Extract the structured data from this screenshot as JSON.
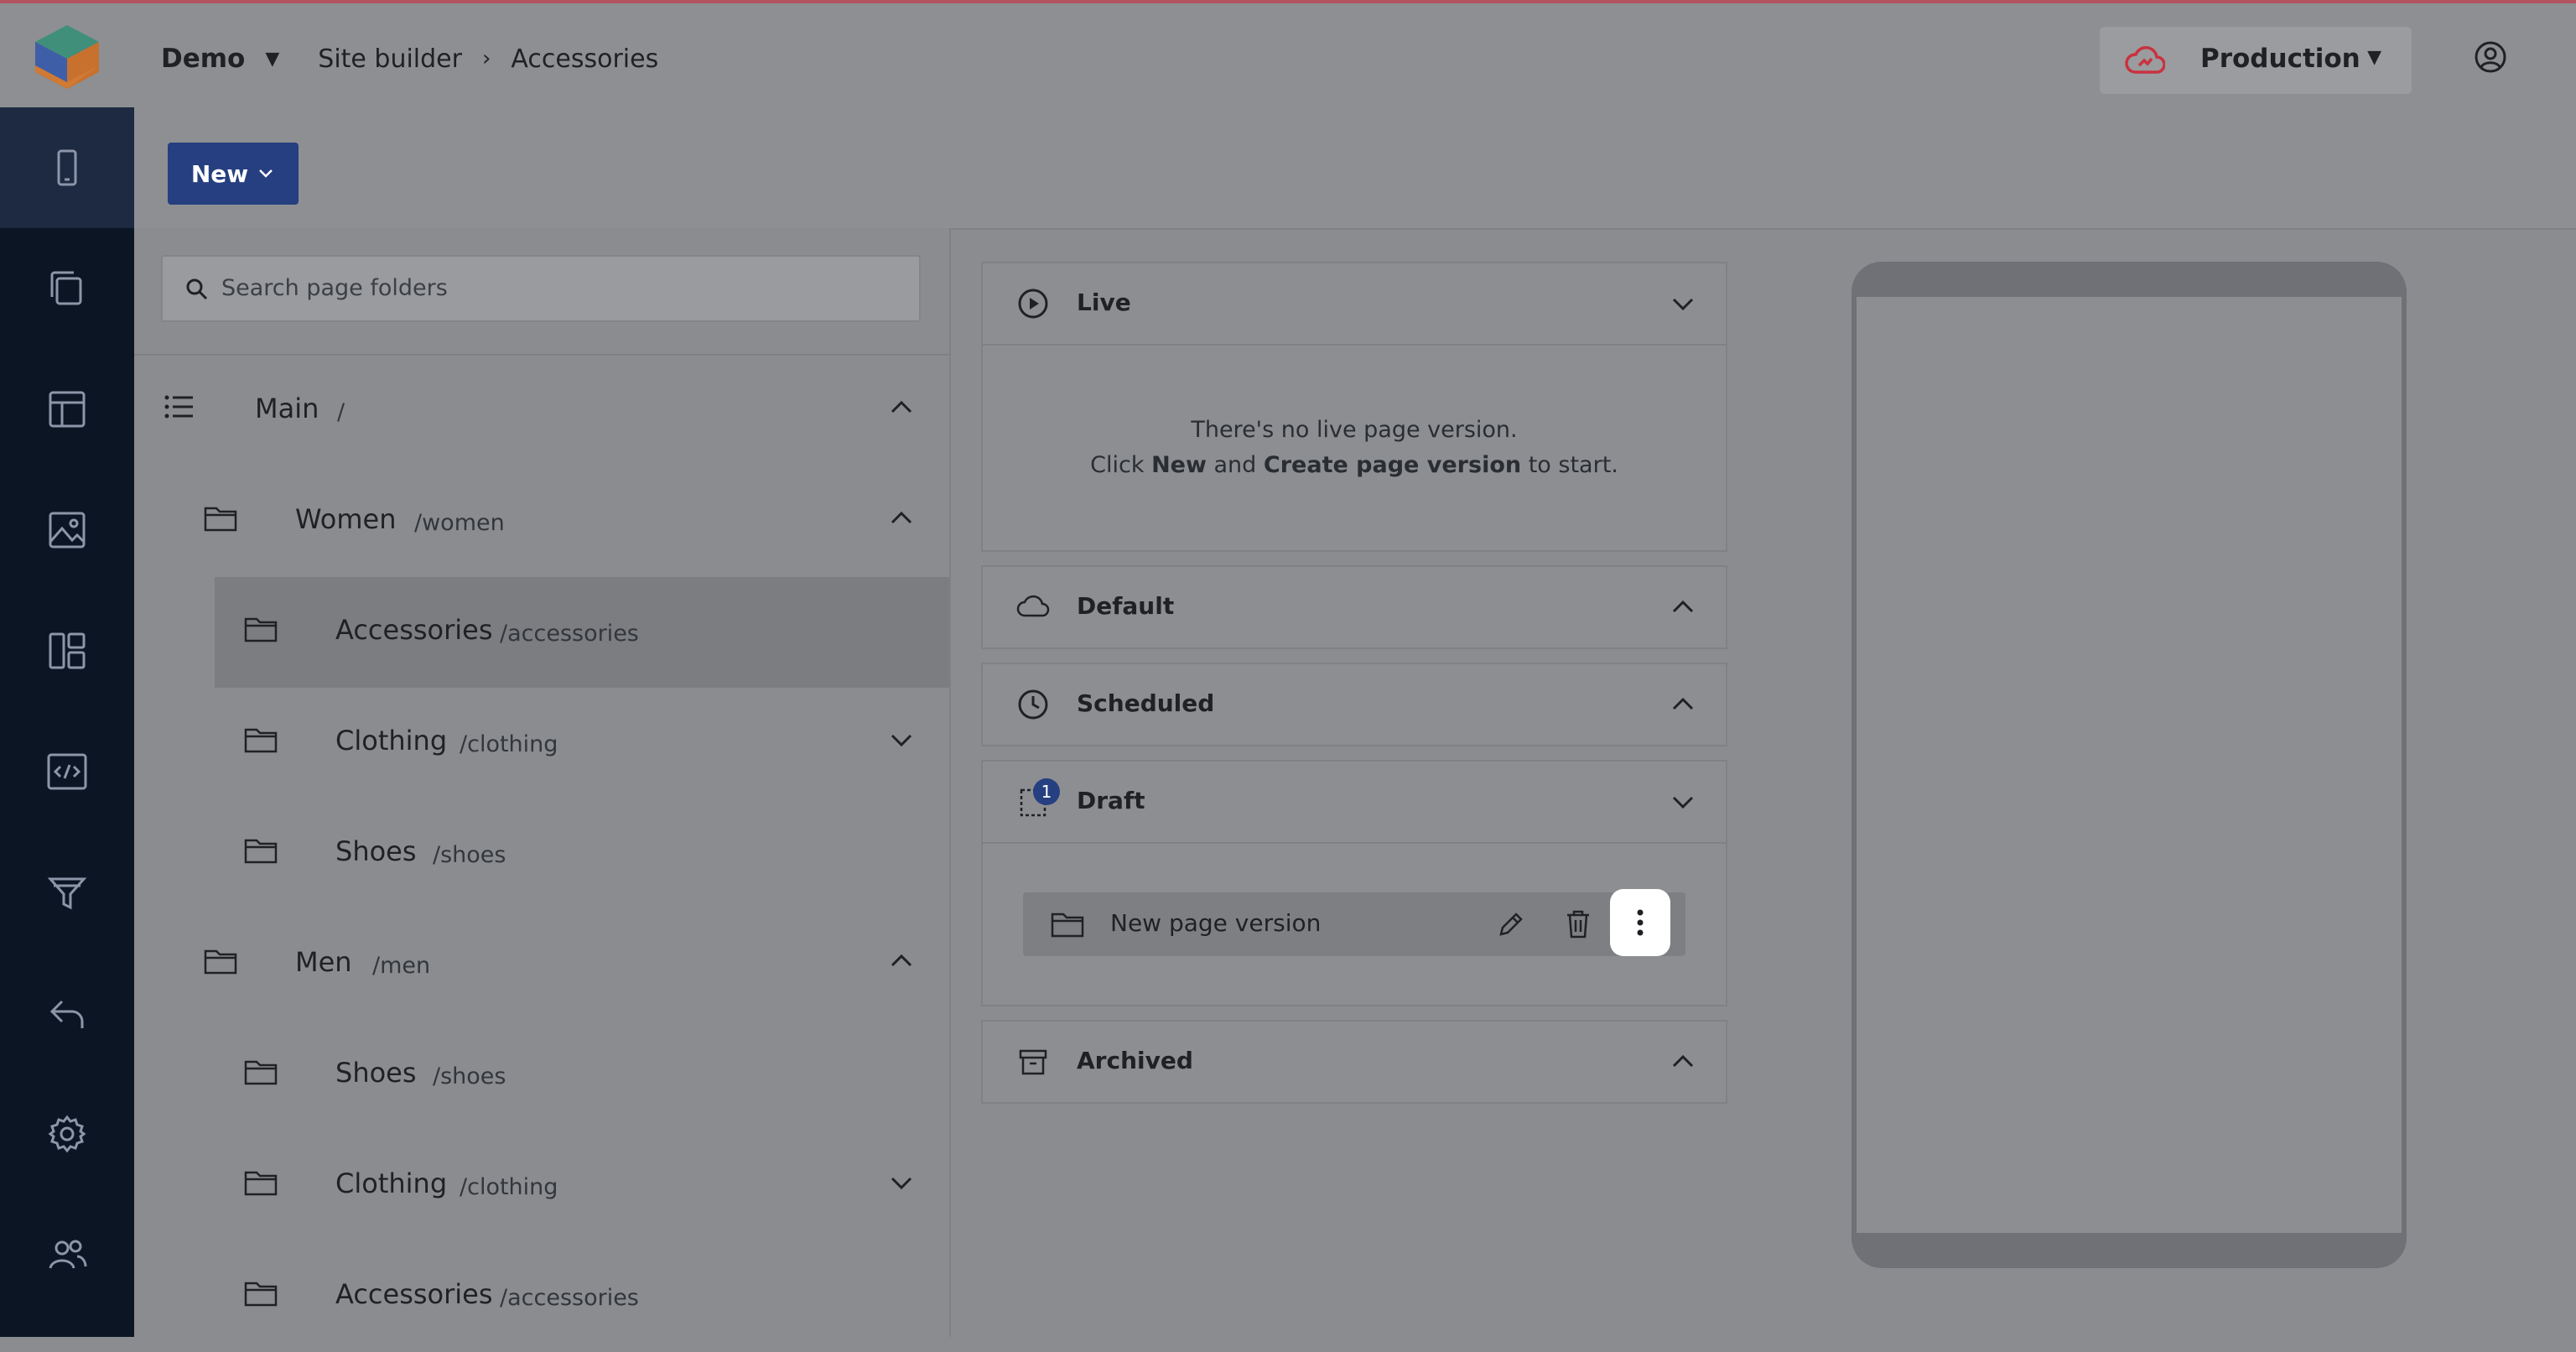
{
  "breadcrumb": {
    "project": "Demo",
    "section": "Site builder",
    "page": "Accessories"
  },
  "environment": {
    "label": "Production",
    "status_color": "#c9323f"
  },
  "toolbar": {
    "new_label": "New"
  },
  "search": {
    "placeholder": "Search page folders"
  },
  "tree": [
    {
      "name": "Main",
      "path": "/",
      "expanded": true
    },
    {
      "name": "Women",
      "path": "/women",
      "expanded": true
    },
    {
      "name": "Accessories",
      "path": "/accessories",
      "selected": true
    },
    {
      "name": "Clothing",
      "path": "/clothing",
      "expanded": false
    },
    {
      "name": "Shoes",
      "path": "/shoes"
    },
    {
      "name": "Men",
      "path": "/men",
      "expanded": true
    },
    {
      "name": "Shoes",
      "path": "/shoes"
    },
    {
      "name": "Clothing",
      "path": "/clothing",
      "expanded": false
    },
    {
      "name": "Accessories",
      "path": "/accessories"
    }
  ],
  "versions": {
    "live": {
      "title": "Live",
      "empty_line1": "There's no live page version.",
      "empty_pre": "Click",
      "empty_new": "New",
      "empty_and": "and",
      "empty_create": "Create page version",
      "empty_post": "to start."
    },
    "default": {
      "title": "Default"
    },
    "scheduled": {
      "title": "Scheduled"
    },
    "draft": {
      "title": "Draft",
      "count": "1",
      "item": "New page version"
    },
    "archived": {
      "title": "Archived"
    }
  },
  "colors": {
    "accent": "#263f80",
    "sidebar": "#0c1524"
  },
  "nav_icons": [
    "device-icon",
    "pages-icon",
    "layout-icon",
    "media-icon",
    "components-icon",
    "code-icon",
    "filter-icon",
    "undo-icon",
    "settings-icon",
    "users-icon"
  ]
}
